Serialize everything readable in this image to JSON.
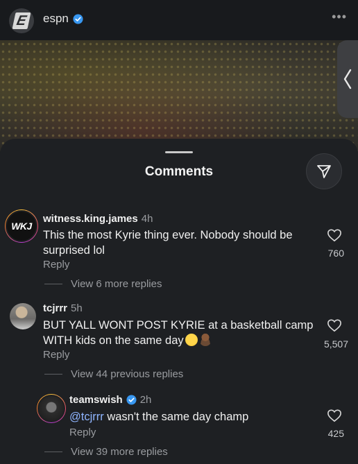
{
  "header": {
    "account_name": "espn",
    "more_label": "•••"
  },
  "sheet": {
    "title": "Comments"
  },
  "comments": [
    {
      "username": "witness.king.james",
      "time": "4h",
      "text": "This the most Kyrie thing ever. Nobody should be surprised lol",
      "reply_label": "Reply",
      "likes": "760",
      "view_replies": "View 6 more replies",
      "avatar_text": "WKJ"
    },
    {
      "username": "tcjrrr",
      "time": "5h",
      "text": "BUT YALL WONT POST KYRIE  at a basketball camp WITH kids on the same day",
      "reply_label": "Reply",
      "likes": "5,507",
      "view_replies": "View 44 previous replies",
      "replies": [
        {
          "username": "teamswish",
          "time": "2h",
          "mention": "@tcjrrr",
          "text": " wasn't the same day champ",
          "reply_label": "Reply",
          "likes": "425",
          "view_replies": "View 39 more replies"
        }
      ]
    }
  ],
  "icons": {
    "verified": "verified-badge-icon",
    "share": "paper-plane-icon",
    "like": "heart-icon",
    "collapse": "chevron-left-icon"
  },
  "colors": {
    "accent": "#3897f0",
    "mention": "#8fb5ff",
    "background": "#1e2023"
  }
}
